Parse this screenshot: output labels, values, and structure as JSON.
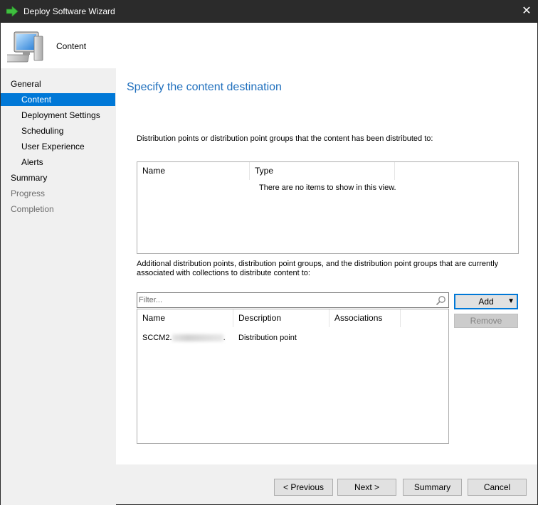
{
  "window": {
    "title": "Deploy Software Wizard",
    "close_glyph": "✕",
    "accent": "#0078d7"
  },
  "header": {
    "title": "Content"
  },
  "sidebar": {
    "items": [
      {
        "label": "General"
      },
      {
        "label": "Content"
      },
      {
        "label": "Deployment Settings"
      },
      {
        "label": "Scheduling"
      },
      {
        "label": "User Experience"
      },
      {
        "label": "Alerts"
      },
      {
        "label": "Summary"
      },
      {
        "label": "Progress"
      },
      {
        "label": "Completion"
      }
    ]
  },
  "main": {
    "title": "Specify the content destination",
    "distributed_label": "Distribution points or distribution point groups that the content has been distributed to:",
    "distributed_list": {
      "columns": [
        "Name",
        "Type"
      ],
      "empty_message": "There are no items to show in this view."
    },
    "additional_label": "Additional distribution points, distribution point groups, and the distribution point groups that are currently associated with collections to distribute content to:",
    "filter": {
      "placeholder": "Filter..."
    },
    "additional_list": {
      "columns": [
        "Name",
        "Description",
        "Associations"
      ],
      "rows": [
        {
          "name": "SCCM2.",
          "name_suffix": ".",
          "description": "Distribution point",
          "associations": ""
        }
      ]
    },
    "add_button": "Add",
    "add_caret": "▼",
    "remove_button": "Remove"
  },
  "footer": {
    "previous": "< Previous",
    "next": "Next >",
    "summary": "Summary",
    "cancel": "Cancel"
  }
}
